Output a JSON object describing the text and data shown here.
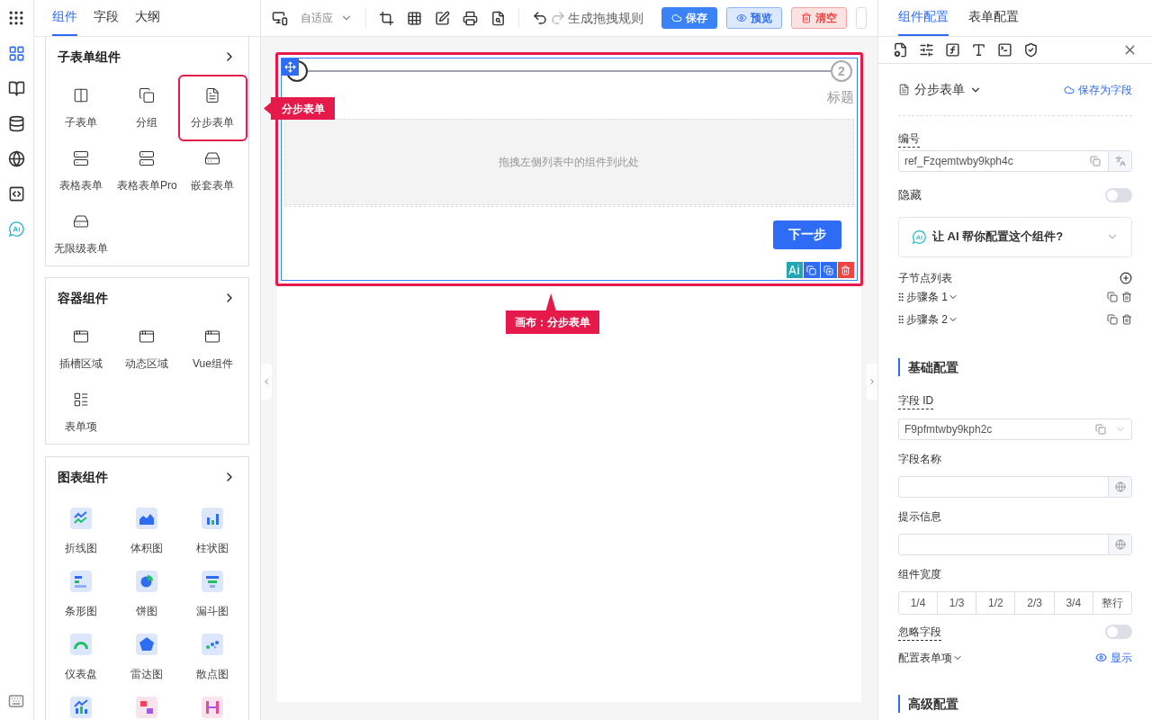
{
  "rail": [
    {
      "selected": true
    },
    {
      "selected": false
    },
    {
      "selected": false
    },
    {
      "selected": false
    },
    {
      "selected": false
    },
    {
      "selected": false
    }
  ],
  "left_tabs": [
    {
      "label": "组件",
      "selected": true
    },
    {
      "label": "字段",
      "selected": false
    },
    {
      "label": "大纲",
      "selected": false
    }
  ],
  "palette": [
    {
      "title": "子表单组件",
      "items": [
        {
          "label": "子表单",
          "highlighted": false
        },
        {
          "label": "分组",
          "highlighted": false
        },
        {
          "label": "分步表单",
          "highlighted": true
        },
        {
          "label": "表格表单",
          "highlighted": false
        },
        {
          "label": "表格表单Pro",
          "highlighted": false
        },
        {
          "label": "嵌套表单",
          "highlighted": false
        },
        {
          "label": "无限级表单",
          "highlighted": false
        }
      ]
    },
    {
      "title": "容器组件",
      "items": [
        {
          "label": "插槽区域",
          "highlighted": false
        },
        {
          "label": "动态区域",
          "highlighted": false
        },
        {
          "label": "Vue组件",
          "highlighted": false
        },
        {
          "label": "表单项",
          "highlighted": false
        }
      ]
    },
    {
      "title": "图表组件",
      "items": [
        {
          "label": "折线图",
          "highlighted": false
        },
        {
          "label": "体积图",
          "highlighted": false
        },
        {
          "label": "柱状图",
          "highlighted": false
        },
        {
          "label": "条形图",
          "highlighted": false
        },
        {
          "label": "饼图",
          "highlighted": false
        },
        {
          "label": "漏斗图",
          "highlighted": false
        },
        {
          "label": "仪表盘",
          "highlighted": false
        },
        {
          "label": "雷达图",
          "highlighted": false
        },
        {
          "label": "散点图",
          "highlighted": false
        },
        {
          "highlighted": false
        },
        {
          "highlighted": false
        },
        {
          "highlighted": false
        }
      ]
    }
  ],
  "toolbar": {
    "layout_select": "自适应",
    "rule_button": "生成拖拽规则",
    "buttons": [
      {
        "label": "保存",
        "kind": "primary"
      },
      {
        "label": "预览",
        "kind": "secondary"
      },
      {
        "label": "清空",
        "kind": "danger"
      }
    ]
  },
  "canvas": {
    "highlighted": true,
    "steps": [
      {
        "selected": true
      },
      {
        "number": "2",
        "label": "标题",
        "selected": false
      }
    ],
    "dropzone": "拖拽左侧列表中的组件到此处",
    "next_button": "下一步"
  },
  "callouts": [
    {
      "text": "分步表单"
    },
    {
      "text": "画布：分步表单"
    }
  ],
  "config": {
    "tabs": [
      {
        "label": "组件配置",
        "selected": true
      },
      {
        "label": "表单配置",
        "selected": false
      }
    ],
    "component": "分步表单",
    "save_link": "保存为字段",
    "ref_label": "编号",
    "ref_value": "ref_Fzqemtwby9kph4c",
    "hidden_label": "隐藏",
    "hidden_on": false,
    "ai_prompt": "让 AI 帮你配置这个组件?",
    "children_label": "子节点列表",
    "children": [
      {
        "label": "步骤条 1"
      },
      {
        "label": "步骤条 2"
      }
    ],
    "basic_title": "基础配置",
    "field_id_label": "字段 ID",
    "field_id_value": "F9pfmtwby9kph2c",
    "field_name_label": "字段名称",
    "hint_label": "提示信息",
    "width_label": "组件宽度",
    "widths": [
      "1/4",
      "1/3",
      "1/2",
      "2/3",
      "3/4",
      "整行"
    ],
    "ignore_label": "忽略字段",
    "ignore_on": false,
    "item_config_label": "配置表单项",
    "show_link": "显示",
    "advanced_title": "高级配置"
  }
}
